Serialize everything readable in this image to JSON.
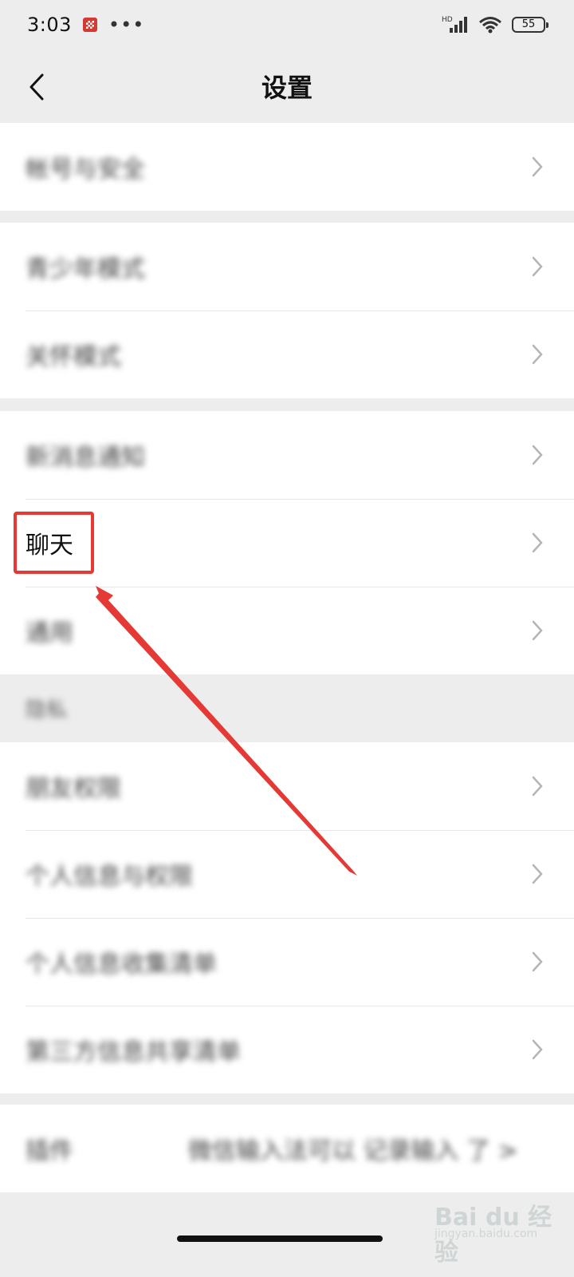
{
  "status_bar": {
    "time": "3:03",
    "more_dots": "•••",
    "network_label": "HD",
    "battery_level": "55"
  },
  "nav": {
    "title": "设置"
  },
  "groups": [
    {
      "items": [
        {
          "label": "帐号与安全"
        }
      ]
    },
    {
      "items": [
        {
          "label": "青少年模式"
        },
        {
          "label": "关怀模式"
        }
      ]
    },
    {
      "items": [
        {
          "label": "新消息通知"
        },
        {
          "label": "聊天"
        },
        {
          "label": "通用"
        }
      ]
    }
  ],
  "section_privacy": {
    "header": "隐私",
    "items": [
      {
        "label": "朋友权限"
      },
      {
        "label": "个人信息与权限"
      },
      {
        "label": "个人信息收集清单"
      },
      {
        "label": "第三方信息共享清单"
      }
    ]
  },
  "version_row": {
    "label": "插件",
    "value": "微信输入法可以 记录输入 了 >"
  },
  "watermark": {
    "brand": "Bai du 经验",
    "url": "jingyan.baidu.com"
  },
  "colors": {
    "background": "#ededed",
    "row_background": "#ffffff",
    "highlight": "#e53935"
  }
}
